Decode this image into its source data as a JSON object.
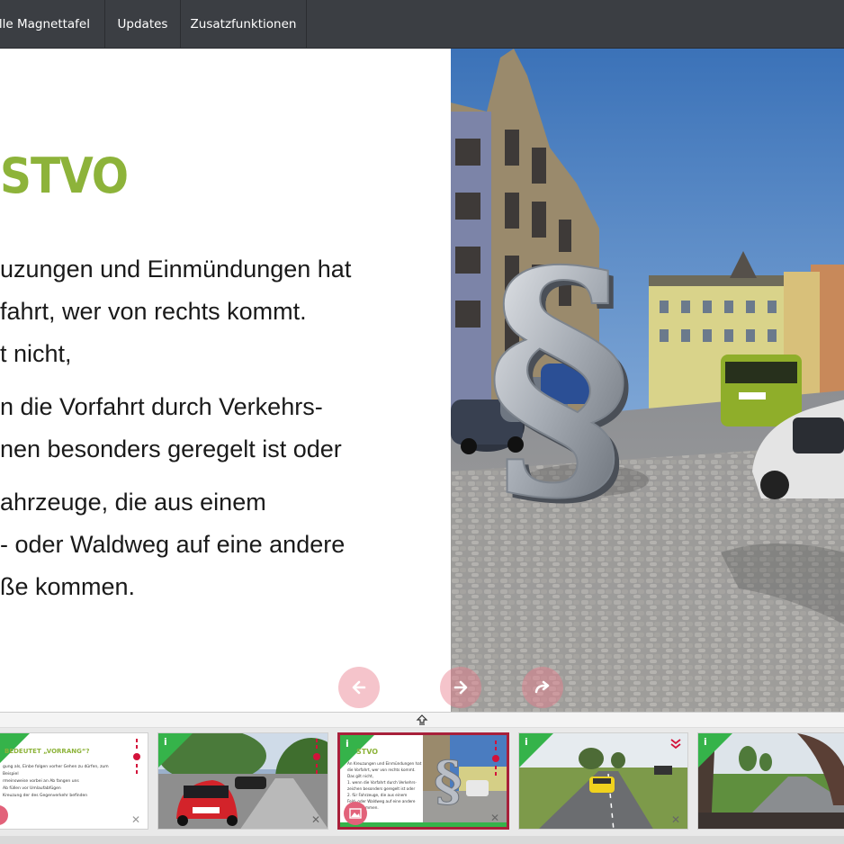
{
  "nav": {
    "items": [
      "elle Magnettafel",
      "Updates",
      "Zusatzfunktionen"
    ]
  },
  "slide": {
    "title": "STVO",
    "lines": [
      "uzungen und Einmündungen hat",
      "fahrt, wer von rechts kommt.",
      "t nicht,",
      "n die Vorfahrt durch Verkehrs-",
      "nen besonders geregelt ist oder",
      "ahrzeuge, die aus einem",
      "- oder Waldweg auf eine andere",
      "ße kommen."
    ]
  },
  "thumbs": [
    {
      "title": "BEDEUTET „VORRANG“?",
      "lines": [
        "gung als, Einbe folgen vorher Gehen zu dürfen, zum Beispiel",
        "rmeinsweise vorbei an Ab fangen uns",
        "Ab füllen vor Umlaufabfügen",
        "Kreuzung der des Gegenverkehr befinden"
      ]
    },
    {
      "title": ""
    },
    {
      "title": "STVO",
      "lines": [
        "An Kreuzungen und Einmündungen hat",
        "die Vorfahrt, wer von rechts kommt.",
        "Das gilt nicht,",
        "1. wenn die Vorfahrt durch Verkehrs-",
        "zeichen besonders geregelt ist oder",
        "2. für Fahrzeuge, die aus einem",
        "Feld- oder Waldweg auf eine andere",
        "Straße kommen."
      ]
    },
    {
      "title": ""
    },
    {
      "title": ""
    }
  ],
  "colors": {
    "accent_green": "#8db33a",
    "info_green": "#35b34a",
    "active_border": "#a8203a",
    "nav_bg": "#3b3e43"
  }
}
